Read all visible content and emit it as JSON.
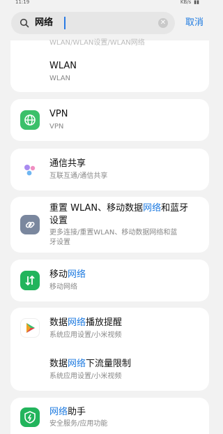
{
  "status": {
    "time": "11:19",
    "speed": "KB/s"
  },
  "search": {
    "query": "网络",
    "cancel_label": "取消"
  },
  "cards": {
    "wlan": {
      "cut_text": "WLAN/WLAN设置/WLAN网络",
      "title": "WLAN",
      "sub": "WLAN"
    },
    "vpn": {
      "title": "VPN",
      "sub": "VPN"
    },
    "share": {
      "title": "通信共享",
      "sub": "互联互通/通信共享"
    },
    "reset": {
      "title_pre": "重置 WLAN、移动数据",
      "title_hl": "网络",
      "title_post": "和蓝牙",
      "title_line2": "设置",
      "sub_line1": "更多连接/重置WLAN、移动数据网络和蓝",
      "sub_line2": "牙设置"
    },
    "mobile": {
      "title_pre": "移动",
      "title_hl": "网络",
      "sub": "移动网络"
    },
    "video": {
      "item1_pre": "数据",
      "item1_hl": "网络",
      "item1_post": "播放提醒",
      "item1_sub": "系统应用设置/小米视频",
      "item2_pre": "数据",
      "item2_hl": "网络",
      "item2_post": "下流量限制",
      "item2_sub": "系统应用设置/小米视频"
    },
    "assistant": {
      "title_hl": "网络",
      "title_post": "助手",
      "sub": "安全服务/应用功能"
    }
  },
  "colors": {
    "accent": "#1d7ae0",
    "vpn_green": "#3cc06a",
    "mobile_green": "#22b45c",
    "reset_gray": "#7a879e"
  }
}
